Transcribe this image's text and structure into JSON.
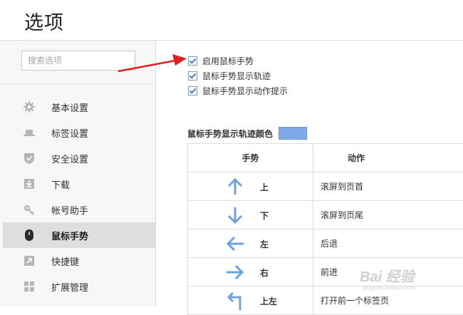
{
  "header": {
    "title": "选项"
  },
  "sidebar": {
    "search_placeholder": "搜索选项",
    "items": [
      {
        "label": "基本设置",
        "icon": "gear-icon"
      },
      {
        "label": "标签设置",
        "icon": "tab-icon"
      },
      {
        "label": "安全设置",
        "icon": "shield-check-icon"
      },
      {
        "label": "下载",
        "icon": "download-icon"
      },
      {
        "label": "帐号助手",
        "icon": "key-icon"
      },
      {
        "label": "鼠标手势",
        "icon": "mouse-icon",
        "active": true
      },
      {
        "label": "快捷键",
        "icon": "shortcut-arrow-icon"
      },
      {
        "label": "扩展管理",
        "icon": "extensions-icon"
      }
    ]
  },
  "main": {
    "checkboxes": [
      {
        "label": "启用鼠标手势",
        "checked": true
      },
      {
        "label": "鼠标手势显示轨迹",
        "checked": true
      },
      {
        "label": "鼠标手势显示动作提示",
        "checked": true
      }
    ],
    "trail_color_label": "鼠标手势显示轨迹颜色",
    "trail_color": "#7fa9e8",
    "table": {
      "header_gesture": "手势",
      "header_action": "动作",
      "rows": [
        {
          "gesture": "上",
          "action": "滚屏到页首",
          "arrow": "arrow-up-icon"
        },
        {
          "gesture": "下",
          "action": "滚屏到页尾",
          "arrow": "arrow-down-icon"
        },
        {
          "gesture": "左",
          "action": "后退",
          "arrow": "arrow-left-icon"
        },
        {
          "gesture": "右",
          "action": "前进",
          "arrow": "arrow-right-icon"
        },
        {
          "gesture": "上左",
          "action": "打开前一个标签页",
          "arrow": "arrow-up-left-icon"
        }
      ]
    }
  },
  "annotation": {
    "arrow_color": "#e02020"
  },
  "watermark": {
    "text": "Bai 经验",
    "url": "jingyan.baidu.com"
  }
}
